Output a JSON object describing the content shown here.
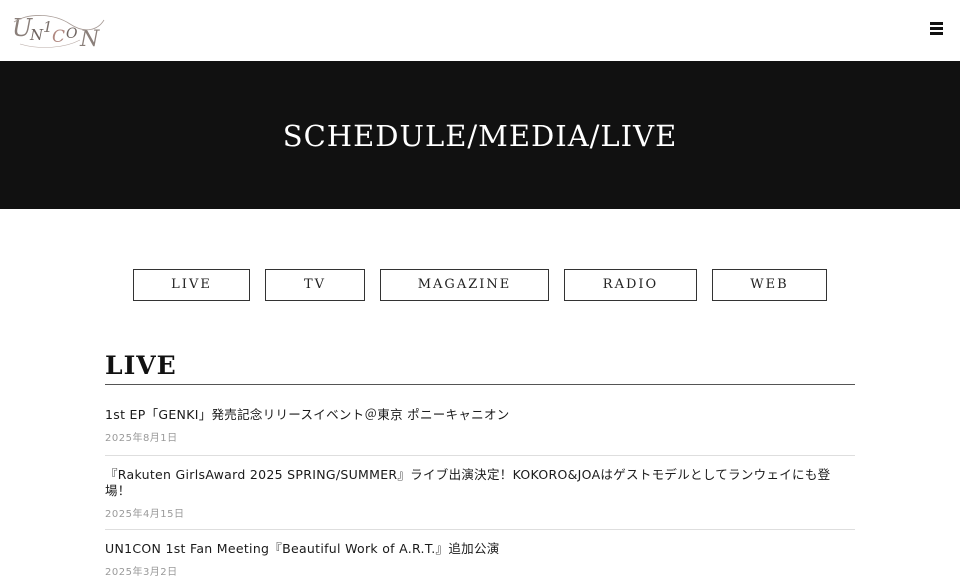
{
  "header": {
    "logo_text": "UN1CON",
    "menu_icon": "hamburger-menu-icon"
  },
  "hero": {
    "title": "SCHEDULE/MEDIA/LIVE"
  },
  "tabs": [
    {
      "label": "LIVE"
    },
    {
      "label": "TV"
    },
    {
      "label": "MAGAZINE"
    },
    {
      "label": "RADIO"
    },
    {
      "label": "WEB"
    }
  ],
  "section": {
    "title": "LIVE",
    "items": [
      {
        "title": "1st EP「GENKI」発売記念リリースイベント＠東京 ポニーキャニオン",
        "date": "2025年8月1日"
      },
      {
        "title": "『Rakuten GirlsAward 2025 SPRING/SUMMER』ライブ出演決定！KOKORO&JOAはゲストモデルとしてランウェイにも登場！",
        "date": "2025年4月15日"
      },
      {
        "title": "UN1CON 1st Fan Meeting『Beautiful Work of A.R.T.』追加公演",
        "date": "2025年3月2日"
      }
    ]
  },
  "colors": {
    "hero_bg": "#111111",
    "page_bg": "#ffffff",
    "text": "#1a1a1a",
    "date_text": "#9a9a9a"
  }
}
